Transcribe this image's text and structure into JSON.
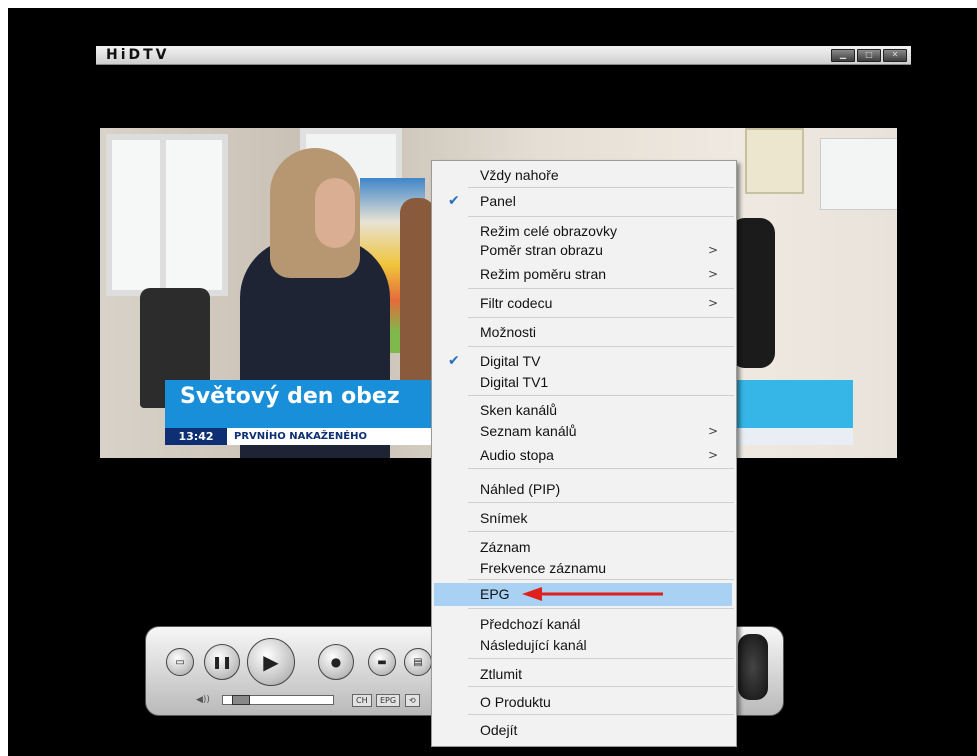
{
  "window": {
    "title": "HiDTV",
    "buttons": [
      "▁",
      "□",
      "✕"
    ]
  },
  "video": {
    "headline": "Světový den obez",
    "ticker_time": "13:42",
    "ticker_text": "PRVNÍHO NAKAŽENÉHO"
  },
  "control_panel": {
    "buttons": [
      "▭",
      "❚❚",
      "▶",
      "●",
      "▬",
      "▤"
    ],
    "vol_icon": "◀))",
    "mini_buttons": [
      "CH",
      "EPG",
      "⟲"
    ],
    "volume_level": 0.1
  },
  "context_menu": {
    "items": [
      {
        "label": "Vždy nahoře",
        "checked": false,
        "submenu": false
      },
      {
        "label": "Panel",
        "checked": true,
        "submenu": false
      },
      {
        "label": "Režim celé obrazovky",
        "checked": false,
        "submenu": false
      },
      {
        "label": "Poměr stran obrazu",
        "checked": false,
        "submenu": true
      },
      {
        "label": "Režim poměru stran",
        "checked": false,
        "submenu": true
      },
      {
        "label": "Filtr codecu",
        "checked": false,
        "submenu": true
      },
      {
        "label": "Možnosti",
        "checked": false,
        "submenu": false
      },
      {
        "label": "Digital TV",
        "checked": true,
        "submenu": false
      },
      {
        "label": "Digital TV1",
        "checked": false,
        "submenu": false
      },
      {
        "label": "Sken kanálů",
        "checked": false,
        "submenu": false
      },
      {
        "label": "Seznam kanálů",
        "checked": false,
        "submenu": true
      },
      {
        "label": "Audio stopa",
        "checked": false,
        "submenu": true
      },
      {
        "label": "Náhled (PIP)",
        "checked": false,
        "submenu": false
      },
      {
        "label": "Snímek",
        "checked": false,
        "submenu": false
      },
      {
        "label": "Záznam",
        "checked": false,
        "submenu": false
      },
      {
        "label": "Frekvence záznamu",
        "checked": false,
        "submenu": false
      },
      {
        "label": "EPG",
        "checked": false,
        "submenu": false,
        "highlighted": true
      },
      {
        "label": "Předchozí kanál",
        "checked": false,
        "submenu": false
      },
      {
        "label": "Následující kanál",
        "checked": false,
        "submenu": false
      },
      {
        "label": "Ztlumit",
        "checked": false,
        "submenu": false
      },
      {
        "label": "O Produktu",
        "checked": false,
        "submenu": false
      },
      {
        "label": "Odejít",
        "checked": false,
        "submenu": false
      }
    ],
    "check_glyph": "✔",
    "submenu_glyph": ">"
  },
  "colors": {
    "highlight": "#a9d1f4",
    "check": "#2b6cc4",
    "annotation_arrow": "#e0201d"
  }
}
